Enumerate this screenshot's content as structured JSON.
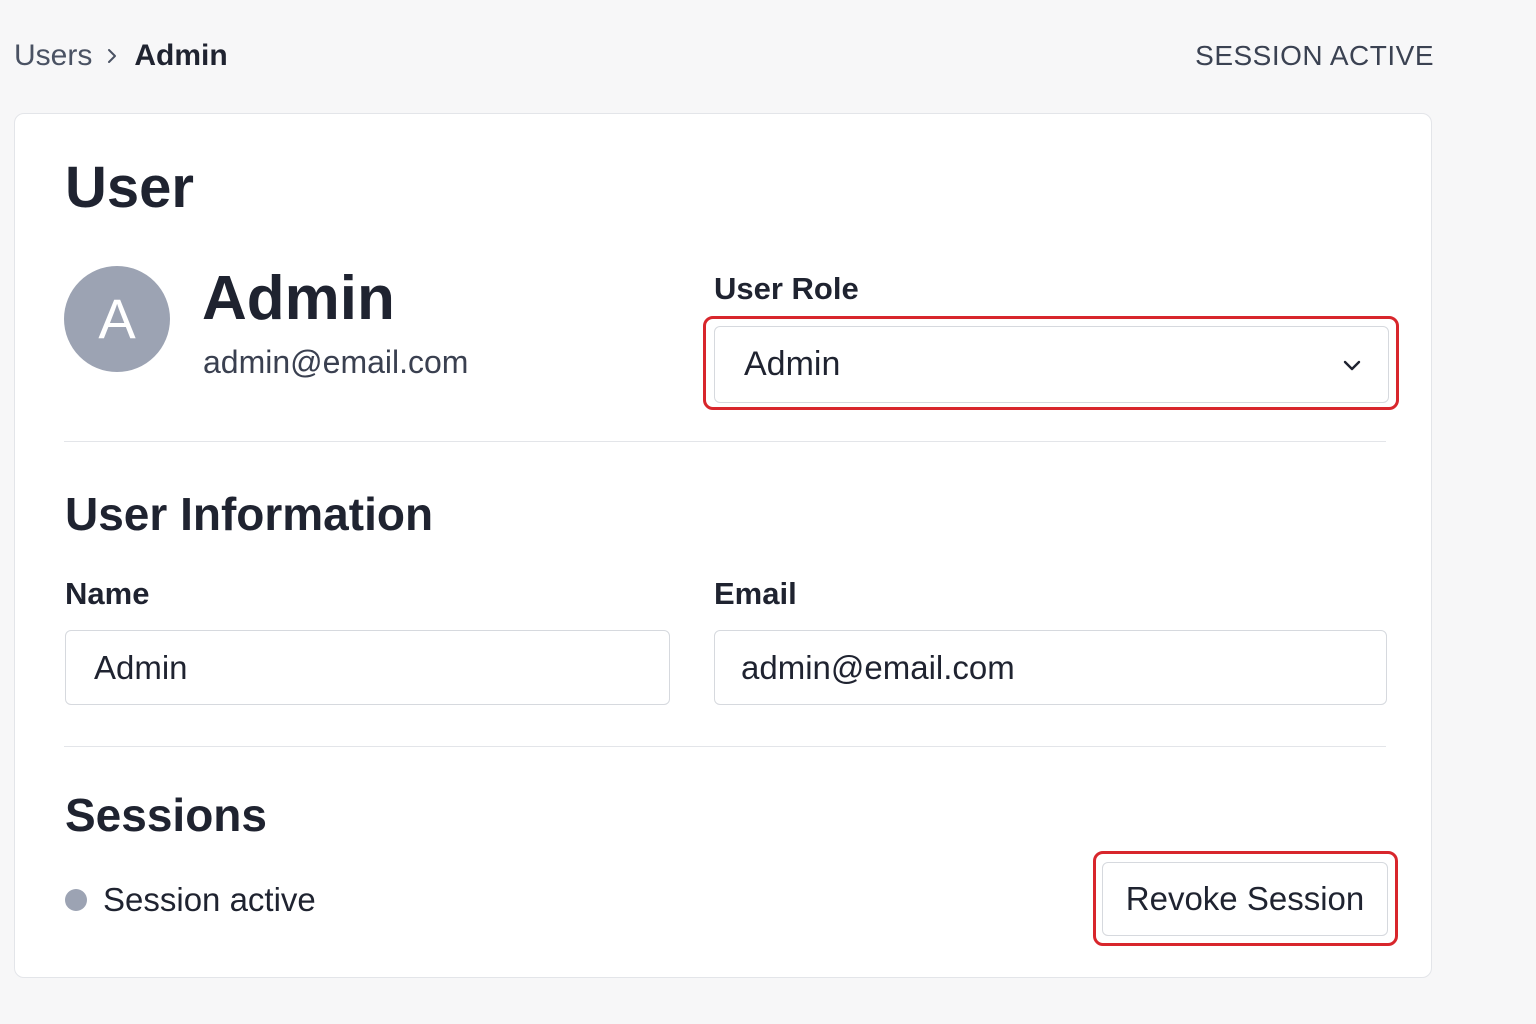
{
  "breadcrumb": {
    "parent": "Users",
    "current": "Admin"
  },
  "header": {
    "session_status": "SESSION ACTIVE"
  },
  "page": {
    "title": "User"
  },
  "profile": {
    "avatar_initial": "A",
    "name": "Admin",
    "email": "admin@email.com"
  },
  "role": {
    "label": "User Role",
    "selected": "Admin"
  },
  "user_information": {
    "title": "User Information",
    "name_label": "Name",
    "name_value": "Admin",
    "email_label": "Email",
    "email_value": "admin@email.com"
  },
  "sessions": {
    "title": "Sessions",
    "status_text": "Session active",
    "revoke_label": "Revoke Session"
  },
  "colors": {
    "highlight_outline": "#d8262c",
    "avatar_bg": "#9ca3b3",
    "session_dot": "#9ca3b3"
  },
  "icons": {
    "breadcrumb_separator": "chevron-right-icon",
    "select_toggle": "chevron-down-icon"
  }
}
